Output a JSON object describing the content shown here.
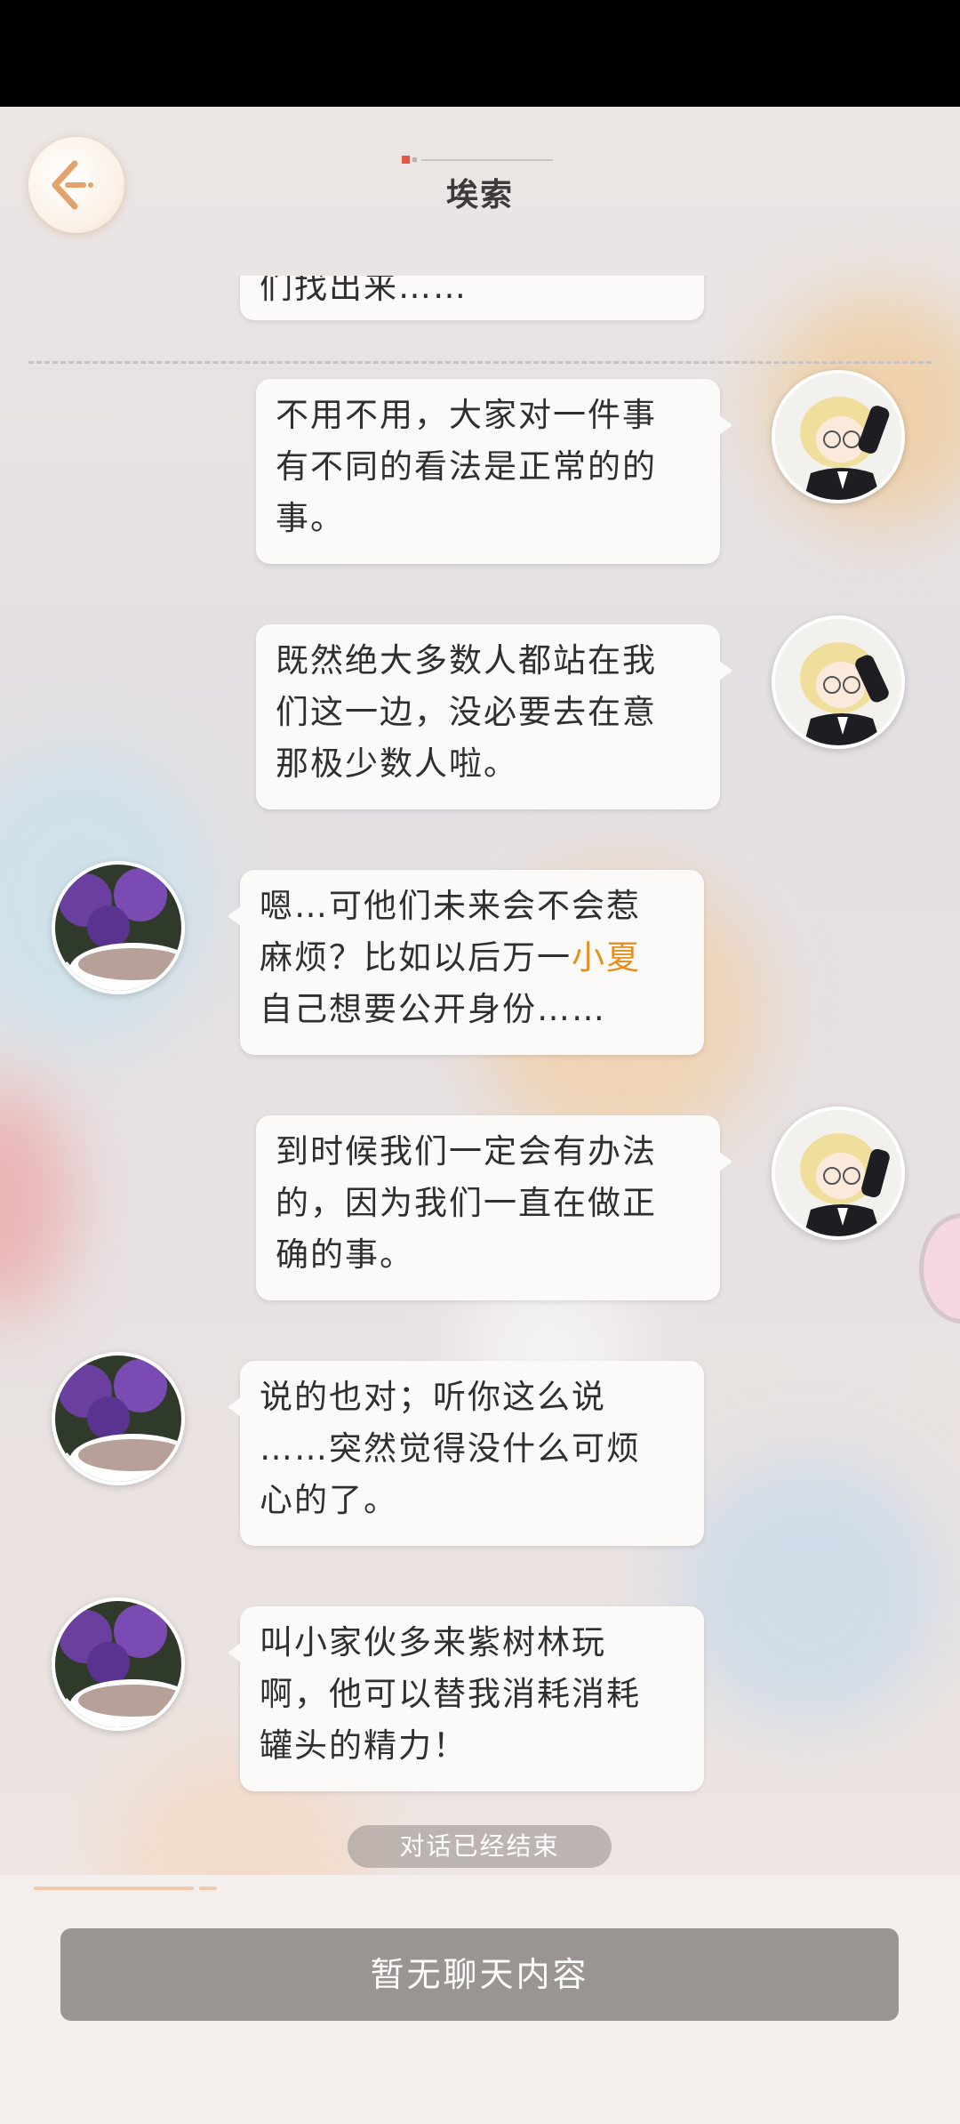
{
  "header": {
    "title": "埃索",
    "back_button": "arrow-left-icon"
  },
  "messages": [
    {
      "side": "left",
      "text": "们找出来……",
      "partial": true
    },
    {
      "side": "right",
      "lines": [
        "不用不用，大家对一件事",
        "有不同的看法是正常的的",
        "事。"
      ]
    },
    {
      "side": "right",
      "lines": [
        "既然绝大多数人都站在我",
        "们这一边，没必要去在意",
        "那极少数人啦。"
      ]
    },
    {
      "side": "left",
      "lines_pre": [
        "嗯…可他们未来会不会惹",
        "麻烦？比如以后万一"
      ],
      "highlight": "小夏",
      "lines_post": [
        "自己想要公开身份……"
      ]
    },
    {
      "side": "right",
      "lines": [
        "到时候我们一定会有办法",
        "的，因为我们一直在做正",
        "确的事。"
      ]
    },
    {
      "side": "left",
      "lines": [
        "说的也对；听你这么说",
        "……突然觉得没什么可烦",
        "心的了。"
      ]
    },
    {
      "side": "left",
      "lines": [
        "叫小家伙多来紫树林玩",
        "啊，他可以替我消耗消耗",
        "罐头的精力！"
      ]
    }
  ],
  "status": {
    "conversation_ended": "对话已经结束"
  },
  "footer": {
    "input_placeholder": "暂无聊天内容"
  },
  "colors": {
    "highlight": "#e6901f",
    "input_button": "#9b9592"
  }
}
